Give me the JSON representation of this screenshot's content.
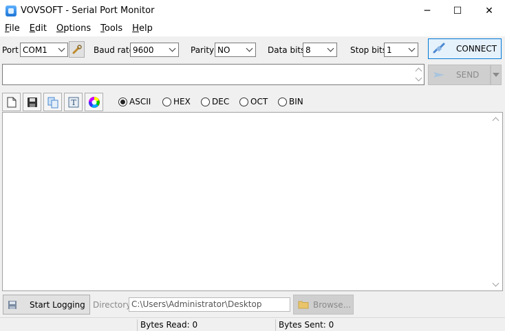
{
  "window": {
    "title": "VOVSOFT - Serial Port Monitor",
    "controls": {
      "minimize": "─",
      "maximize": "☐",
      "close": "✕"
    }
  },
  "menu": [
    {
      "accel": "F",
      "rest": "ile"
    },
    {
      "accel": "E",
      "rest": "dit"
    },
    {
      "accel": "O",
      "rest": "ptions"
    },
    {
      "accel": "T",
      "rest": "ools"
    },
    {
      "accel": "H",
      "rest": "elp"
    }
  ],
  "settings": {
    "port_label": "Port",
    "port_value": "COM1",
    "baud_label": "Baud rate",
    "baud_value": "9600",
    "parity_label": "Parity",
    "parity_value": "NO",
    "databits_label": "Data bits",
    "databits_value": "8",
    "stopbits_label": "Stop bits",
    "stopbits_value": "1",
    "connect_label": "CONNECT"
  },
  "send": {
    "input_value": "",
    "send_label": "SEND"
  },
  "format": {
    "options": [
      "ASCII",
      "HEX",
      "DEC",
      "OCT",
      "BIN"
    ],
    "selected": "ASCII"
  },
  "output": {
    "text": ""
  },
  "logging": {
    "start_label": "Start Logging",
    "directory_label": "Directory:",
    "directory_value": "C:\\Users\\Administrator\\Desktop",
    "browse_label": "Browse..."
  },
  "status": {
    "bytes_read": "Bytes Read: 0",
    "bytes_sent": "Bytes Sent: 0"
  },
  "colors": {
    "accent": "#0078d7",
    "panel": "#f0f0f0"
  }
}
